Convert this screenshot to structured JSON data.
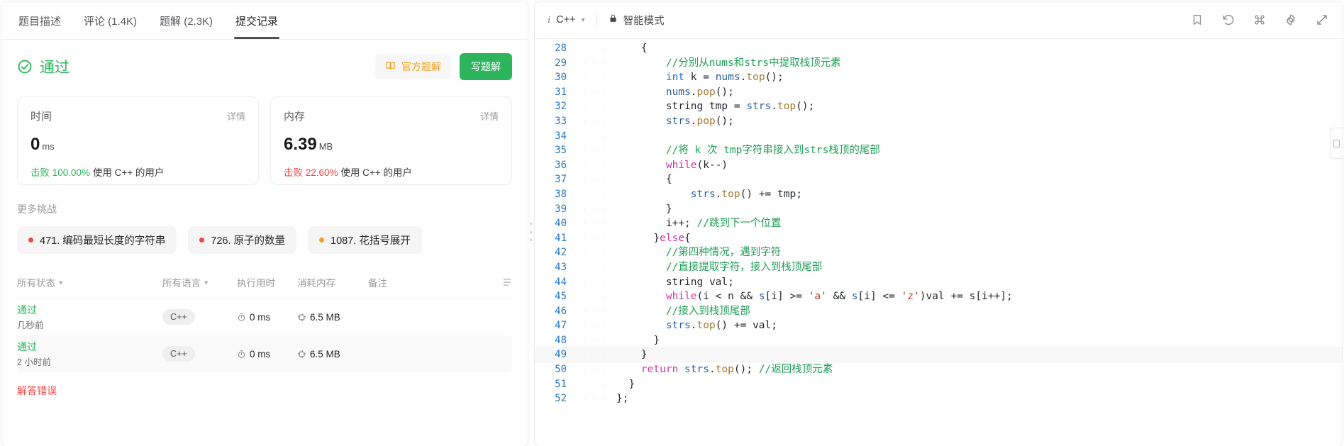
{
  "left": {
    "tabs": [
      {
        "label": "题目描述",
        "active": false
      },
      {
        "label": "评论 (1.4K)",
        "active": false
      },
      {
        "label": "题解 (2.3K)",
        "active": false
      },
      {
        "label": "提交记录",
        "active": true
      }
    ],
    "verdict": {
      "status": "通过",
      "status_color": "#2db55d",
      "icon": "check-circle-icon"
    },
    "actions": {
      "official_solution": "官方题解",
      "official_icon": "book-icon",
      "write_solution": "写题解"
    },
    "stats": [
      {
        "title": "时间",
        "detail_label": "详情",
        "value": "0",
        "unit": "ms",
        "beat_prefix": "击败",
        "beat_pct": "100.00%",
        "beat_suffix": "使用 C++ 的用户",
        "pct_color": "#2db55d"
      },
      {
        "title": "内存",
        "detail_label": "详情",
        "value": "6.39",
        "unit": "MB",
        "beat_prefix": "击败",
        "beat_pct": "22.60%",
        "beat_suffix": "使用 C++ 的用户",
        "pct_color": "#ef4743"
      }
    ],
    "more_challenges_title": "更多挑战",
    "challenges": [
      {
        "label": "471. 编码最短长度的字符串",
        "difficulty_color": "#ef4743"
      },
      {
        "label": "726. 原子的数量",
        "difficulty_color": "#ef4743"
      },
      {
        "label": "1087. 花括号展开",
        "difficulty_color": "#f0a020"
      }
    ],
    "table": {
      "headers": {
        "status": "所有状态",
        "language": "所有语言",
        "runtime": "执行用时",
        "memory": "消耗内存",
        "note": "备注"
      },
      "rows": [
        {
          "status": "通过",
          "status_color": "#2db55d",
          "time_ago": "几秒前",
          "language": "C++",
          "runtime": "0 ms",
          "memory": "6.5 MB",
          "note": ""
        },
        {
          "status": "通过",
          "status_color": "#2db55d",
          "time_ago": "2 小时前",
          "language": "C++",
          "runtime": "0 ms",
          "memory": "6.5 MB",
          "note": ""
        },
        {
          "status": "解答错误",
          "status_color": "#ef4743",
          "time_ago": "",
          "language": "",
          "runtime": "",
          "memory": "",
          "note": ""
        }
      ]
    }
  },
  "right": {
    "toolbar": {
      "info_icon": "info-icon",
      "language": "C++",
      "chevron_icon": "chevron-down-icon",
      "lock_icon": "lock-icon",
      "smart_mode": "智能模式",
      "icons": [
        "bookmark-icon",
        "history-revert-icon",
        "command-icon",
        "gear-icon",
        "expand-icon"
      ]
    },
    "editor": {
      "first_line": 28,
      "highlight_line": 49,
      "lines": [
        {
          "n": 28,
          "indent": 2,
          "tokens": [
            {
              "t": "op",
              "s": "{"
            }
          ]
        },
        {
          "n": 29,
          "indent": 4,
          "tokens": [
            {
              "t": "cm",
              "s": "//分别从nums和strs中提取栈顶元素"
            }
          ]
        },
        {
          "n": 30,
          "indent": 4,
          "tokens": [
            {
              "t": "kt",
              "s": "int"
            },
            {
              "t": "id",
              "s": " k = "
            },
            {
              "t": "vr",
              "s": "nums"
            },
            {
              "t": "op",
              "s": "."
            },
            {
              "t": "fn",
              "s": "top"
            },
            {
              "t": "op",
              "s": "();"
            }
          ]
        },
        {
          "n": 31,
          "indent": 4,
          "tokens": [
            {
              "t": "vr",
              "s": "nums"
            },
            {
              "t": "op",
              "s": "."
            },
            {
              "t": "fn",
              "s": "pop"
            },
            {
              "t": "op",
              "s": "();"
            }
          ]
        },
        {
          "n": 32,
          "indent": 4,
          "tokens": [
            {
              "t": "id",
              "s": "string tmp = "
            },
            {
              "t": "vr",
              "s": "strs"
            },
            {
              "t": "op",
              "s": "."
            },
            {
              "t": "fn",
              "s": "top"
            },
            {
              "t": "op",
              "s": "();"
            }
          ]
        },
        {
          "n": 33,
          "indent": 4,
          "tokens": [
            {
              "t": "vr",
              "s": "strs"
            },
            {
              "t": "op",
              "s": "."
            },
            {
              "t": "fn",
              "s": "pop"
            },
            {
              "t": "op",
              "s": "();"
            }
          ]
        },
        {
          "n": 34,
          "indent": 0,
          "tokens": []
        },
        {
          "n": 35,
          "indent": 4,
          "tokens": [
            {
              "t": "cm",
              "s": "//将 k 次 tmp字符串接入到strs栈顶的尾部"
            }
          ]
        },
        {
          "n": 36,
          "indent": 4,
          "tokens": [
            {
              "t": "k",
              "s": "while"
            },
            {
              "t": "op",
              "s": "(k--)"
            }
          ]
        },
        {
          "n": 37,
          "indent": 4,
          "tokens": [
            {
              "t": "op",
              "s": "{"
            }
          ]
        },
        {
          "n": 38,
          "indent": 6,
          "tokens": [
            {
              "t": "vr",
              "s": "strs"
            },
            {
              "t": "op",
              "s": "."
            },
            {
              "t": "fn",
              "s": "top"
            },
            {
              "t": "op",
              "s": "() += tmp;"
            }
          ]
        },
        {
          "n": 39,
          "indent": 4,
          "tokens": [
            {
              "t": "op",
              "s": "}"
            }
          ]
        },
        {
          "n": 40,
          "indent": 4,
          "tokens": [
            {
              "t": "op",
              "s": "i++; "
            },
            {
              "t": "cm",
              "s": "//跳到下一个位置"
            }
          ]
        },
        {
          "n": 41,
          "indent": 3,
          "tokens": [
            {
              "t": "op",
              "s": "}"
            },
            {
              "t": "k",
              "s": "else"
            },
            {
              "t": "op",
              "s": "{"
            }
          ]
        },
        {
          "n": 42,
          "indent": 4,
          "tokens": [
            {
              "t": "cm",
              "s": "//第四种情况，遇到字符"
            }
          ]
        },
        {
          "n": 43,
          "indent": 4,
          "tokens": [
            {
              "t": "cm",
              "s": "//直接提取字符，接入到栈顶尾部"
            }
          ]
        },
        {
          "n": 44,
          "indent": 4,
          "tokens": [
            {
              "t": "id",
              "s": "string val;"
            }
          ]
        },
        {
          "n": 45,
          "indent": 4,
          "tokens": [
            {
              "t": "k",
              "s": "while"
            },
            {
              "t": "op",
              "s": "(i < n && "
            },
            {
              "t": "vr",
              "s": "s"
            },
            {
              "t": "op",
              "s": "[i] >= "
            },
            {
              "t": "st",
              "s": "'a'"
            },
            {
              "t": "op",
              "s": " && "
            },
            {
              "t": "vr",
              "s": "s"
            },
            {
              "t": "op",
              "s": "[i] <= "
            },
            {
              "t": "st",
              "s": "'z'"
            },
            {
              "t": "op",
              "s": ")val += s[i++];"
            }
          ]
        },
        {
          "n": 46,
          "indent": 4,
          "tokens": [
            {
              "t": "cm",
              "s": "//接入到栈顶尾部"
            }
          ]
        },
        {
          "n": 47,
          "indent": 4,
          "tokens": [
            {
              "t": "vr",
              "s": "strs"
            },
            {
              "t": "op",
              "s": "."
            },
            {
              "t": "fn",
              "s": "top"
            },
            {
              "t": "op",
              "s": "() += val;"
            }
          ]
        },
        {
          "n": 48,
          "indent": 3,
          "tokens": [
            {
              "t": "op",
              "s": "}"
            }
          ]
        },
        {
          "n": 49,
          "indent": 2,
          "tokens": [
            {
              "t": "op",
              "s": "}"
            }
          ]
        },
        {
          "n": 50,
          "indent": 2,
          "tokens": [
            {
              "t": "k",
              "s": "return"
            },
            {
              "t": "op",
              "s": " "
            },
            {
              "t": "vr",
              "s": "strs"
            },
            {
              "t": "op",
              "s": "."
            },
            {
              "t": "fn",
              "s": "top"
            },
            {
              "t": "op",
              "s": "(); "
            },
            {
              "t": "cm",
              "s": "//返回栈顶元素"
            }
          ]
        },
        {
          "n": 51,
          "indent": 1,
          "tokens": [
            {
              "t": "op",
              "s": "}"
            }
          ]
        },
        {
          "n": 52,
          "indent": 0,
          "tokens": [
            {
              "t": "op",
              "s": "};"
            }
          ]
        }
      ]
    },
    "edge_tab_icon": "panel-collapse-icon"
  }
}
